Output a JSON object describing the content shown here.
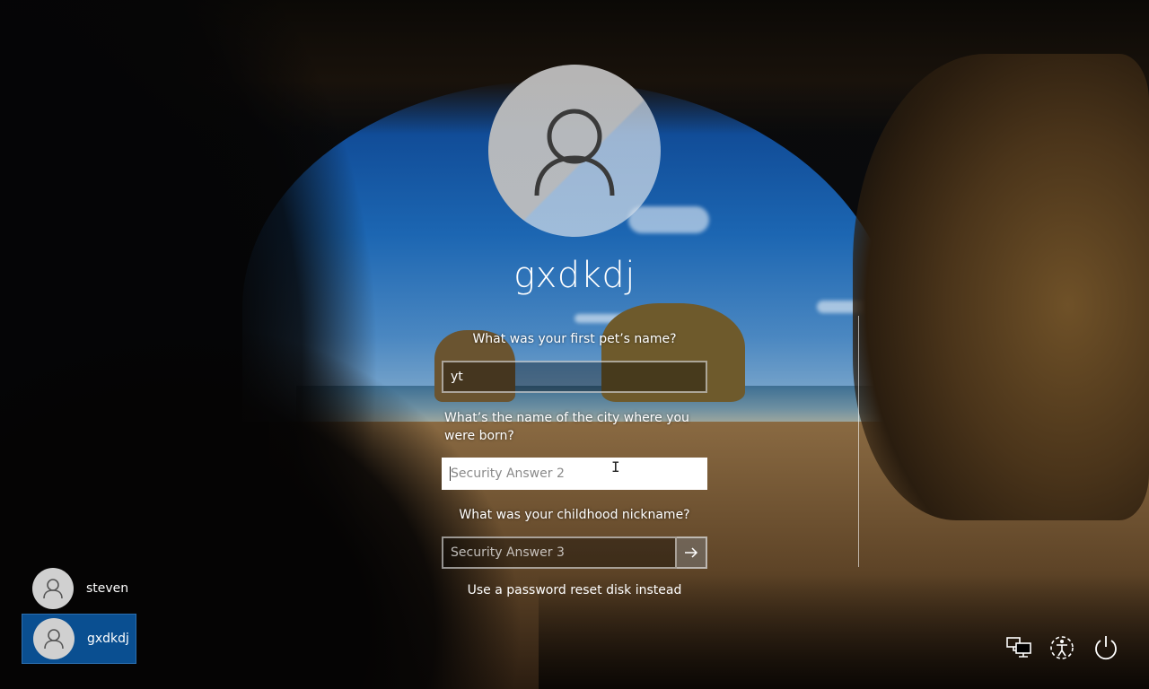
{
  "login": {
    "username": "gxdkdj",
    "questions": [
      {
        "label": "What was your first pet’s name?",
        "value": "yt",
        "placeholder": ""
      },
      {
        "label": "What’s the name of the city where you were born?",
        "value": "",
        "placeholder": "Security Answer 2"
      },
      {
        "label": "What was your childhood nickname?",
        "value": "",
        "placeholder": "Security Answer 3"
      }
    ],
    "reset_link": "Use a password reset disk instead"
  },
  "users": [
    {
      "name": "steven",
      "selected": false
    },
    {
      "name": "gxdkdj",
      "selected": true
    }
  ],
  "icons": {
    "avatar": "user-silhouette-icon",
    "submit": "arrow-right-icon",
    "network": "network-icon",
    "ease_of_access": "ease-of-access-icon",
    "power": "power-icon"
  },
  "colors": {
    "selected_user_bg": "#0a4f91",
    "avatar_gray": "#c0c0c0"
  }
}
